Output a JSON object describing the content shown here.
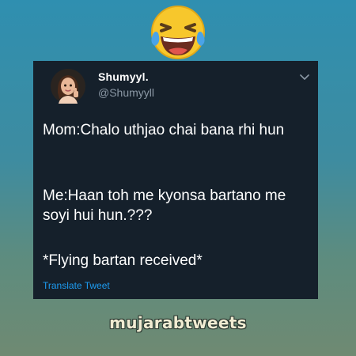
{
  "emoji": {
    "icon": "face-with-tears-of-joy-icon"
  },
  "tweet": {
    "author_name": "Shumyyl.",
    "author_handle": "@Shumyyll",
    "paragraphs": [
      "Mom:Chalo uthjao chai bana rhi hun",
      "Me:Haan toh me kyonsa bartano me soyi hui hun.???",
      "*Flying bartan received*"
    ],
    "translate_label": "Translate Tweet",
    "colors": {
      "background": "#15202b",
      "text": "#ffffff",
      "muted": "#8b98a5",
      "link": "#1d9bf0"
    }
  },
  "watermark": {
    "text": "mujarabtweets"
  }
}
